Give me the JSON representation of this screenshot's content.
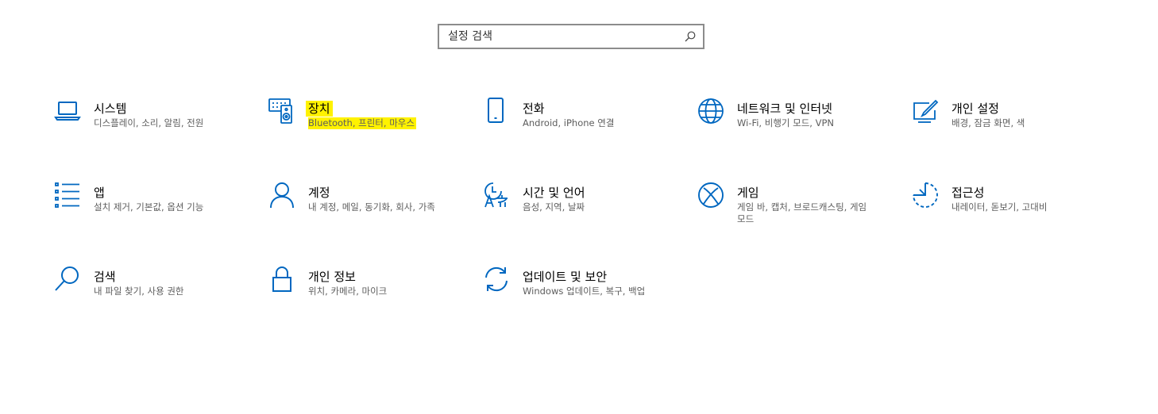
{
  "search": {
    "placeholder": "설정 검색",
    "icon": "search-icon"
  },
  "accent_color": "#0067c0",
  "highlight_color": "#fff200",
  "tiles": [
    {
      "id": "system",
      "title": "시스템",
      "desc": "디스플레이, 소리, 알림, 전원",
      "icon": "laptop-icon"
    },
    {
      "id": "devices",
      "title": "장치",
      "desc": "Bluetooth, 프린터, 마우스",
      "icon": "keyboard-speaker-icon",
      "highlighted": true
    },
    {
      "id": "phone",
      "title": "전화",
      "desc": "Android, iPhone 연결",
      "icon": "phone-icon"
    },
    {
      "id": "network",
      "title": "네트워크 및 인터넷",
      "desc": "Wi-Fi, 비행기 모드, VPN",
      "icon": "globe-icon"
    },
    {
      "id": "personalization",
      "title": "개인 설정",
      "desc": "배경, 잠금 화면, 색",
      "icon": "paint-pen-icon"
    },
    {
      "id": "apps",
      "title": "앱",
      "desc": "설치 제거, 기본값, 옵션 기능",
      "icon": "app-list-icon"
    },
    {
      "id": "accounts",
      "title": "계정",
      "desc": "내 계정, 메일, 동기화, 회사, 가족",
      "icon": "person-icon"
    },
    {
      "id": "time-language",
      "title": "시간 및 언어",
      "desc": "음성, 지역, 날짜",
      "icon": "time-language-icon"
    },
    {
      "id": "gaming",
      "title": "게임",
      "desc": "게임 바, 캡처, 브로드캐스팅, 게임 모드",
      "icon": "xbox-icon"
    },
    {
      "id": "ease-of-access",
      "title": "접근성",
      "desc": "내레이터, 돋보기, 고대비",
      "icon": "ease-of-access-icon"
    },
    {
      "id": "search",
      "title": "검색",
      "desc": "내 파일 찾기, 사용 권한",
      "icon": "magnifier-icon"
    },
    {
      "id": "privacy",
      "title": "개인 정보",
      "desc": "위치, 카메라, 마이크",
      "icon": "lock-icon"
    },
    {
      "id": "update-security",
      "title": "업데이트 및 보안",
      "desc": "Windows 업데이트, 복구, 백업",
      "icon": "sync-icon"
    }
  ]
}
